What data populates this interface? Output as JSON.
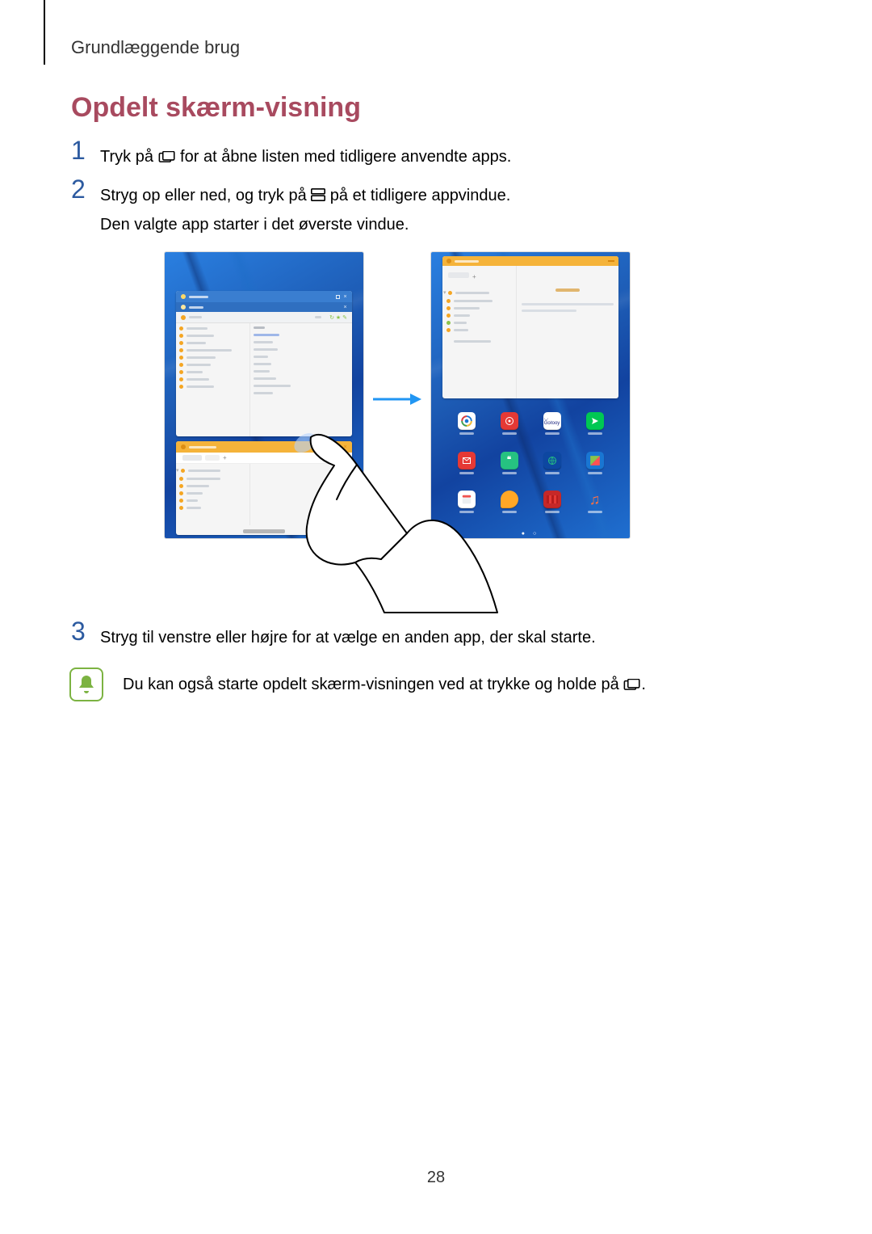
{
  "page": {
    "section_header": "Grundlæggende brug",
    "number": "28"
  },
  "heading": "Opdelt skærm-visning",
  "steps": {
    "n1": "1",
    "s1a": "Tryk på ",
    "s1b": " for at åbne listen med tidligere anvendte apps.",
    "n2": "2",
    "s2a": "Stryg op eller ned, og tryk på ",
    "s2b": " på et tidligere appvindue.",
    "s2c": "Den valgte app starter i det øverste vindue.",
    "n3": "3",
    "s3": "Stryg til venstre eller højre for at vælge en anden app, der skal starte."
  },
  "note": {
    "a": "Du kan også starte opdelt skærm-visningen ved at trykke og holde på ",
    "b": "."
  }
}
